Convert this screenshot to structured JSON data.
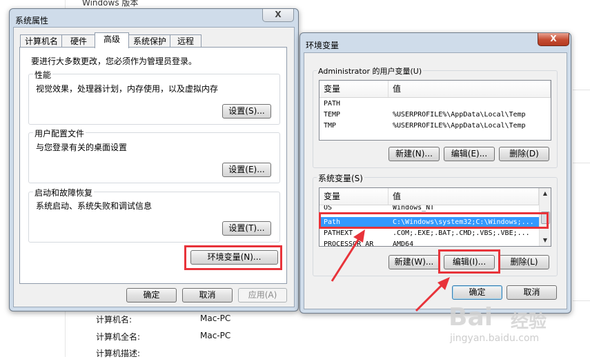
{
  "background": {
    "title": "Windows 版本",
    "info": [
      {
        "label": "计算机名:",
        "value": "Mac-PC"
      },
      {
        "label": "计算机全名:",
        "value": "Mac-PC"
      },
      {
        "label": "计算机描述:",
        "value": ""
      }
    ]
  },
  "sysprops": {
    "title": "系统属性",
    "close": "X",
    "tabs": [
      "计算机名",
      "硬件",
      "高级",
      "系统保护",
      "远程"
    ],
    "active_tab": "高级",
    "notice": "要进行大多数更改，您必须作为管理员登录。",
    "groups": {
      "performance": {
        "title": "性能",
        "desc": "视觉效果，处理器计划，内存使用，以及虚拟内存",
        "button": "设置(S)..."
      },
      "profile": {
        "title": "用户配置文件",
        "desc": "与您登录有关的桌面设置",
        "button": "设置(E)..."
      },
      "startup": {
        "title": "启动和故障恢复",
        "desc": "系统启动、系统失败和调试信息",
        "button": "设置(T)..."
      }
    },
    "env_button": "环境变量(N)...",
    "ok": "确定",
    "cancel": "取消",
    "apply": "应用(A)"
  },
  "envvars": {
    "title": "环境变量",
    "close": "X",
    "user_group": "Administrator 的用户变量(U)",
    "columns": {
      "var": "变量",
      "value": "值"
    },
    "user_rows": [
      {
        "var": "PATH",
        "value": ""
      },
      {
        "var": "TEMP",
        "value": "%USERPROFILE%\\AppData\\Local\\Temp"
      },
      {
        "var": "TMP",
        "value": "%USERPROFILE%\\AppData\\Local\\Temp"
      }
    ],
    "user_buttons": {
      "new": "新建(N)...",
      "edit": "编辑(E)...",
      "delete": "删除(D)"
    },
    "sys_group": "系统变量(S)",
    "sys_rows": [
      {
        "var": "OS",
        "value": "Windows_NT"
      },
      {
        "var": "Path",
        "value": "C:\\Windows\\system32;C:\\Windows;..."
      },
      {
        "var": "PATHEXT",
        "value": ".COM;.EXE;.BAT;.CMD;.VBS;.VBE;..."
      },
      {
        "var": "PROCESSOR_AR",
        "value": "AMD64"
      }
    ],
    "selected_row": "Path",
    "sys_buttons": {
      "new": "新建(W)...",
      "edit": "编辑(I)...",
      "delete": "删除(L)"
    },
    "ok": "确定",
    "cancel": "取消"
  },
  "annotation": {
    "color": "#e8333a"
  },
  "watermark": {
    "logo": "Bai",
    "text": "经验",
    "url": "jingyan.baidu.com"
  }
}
